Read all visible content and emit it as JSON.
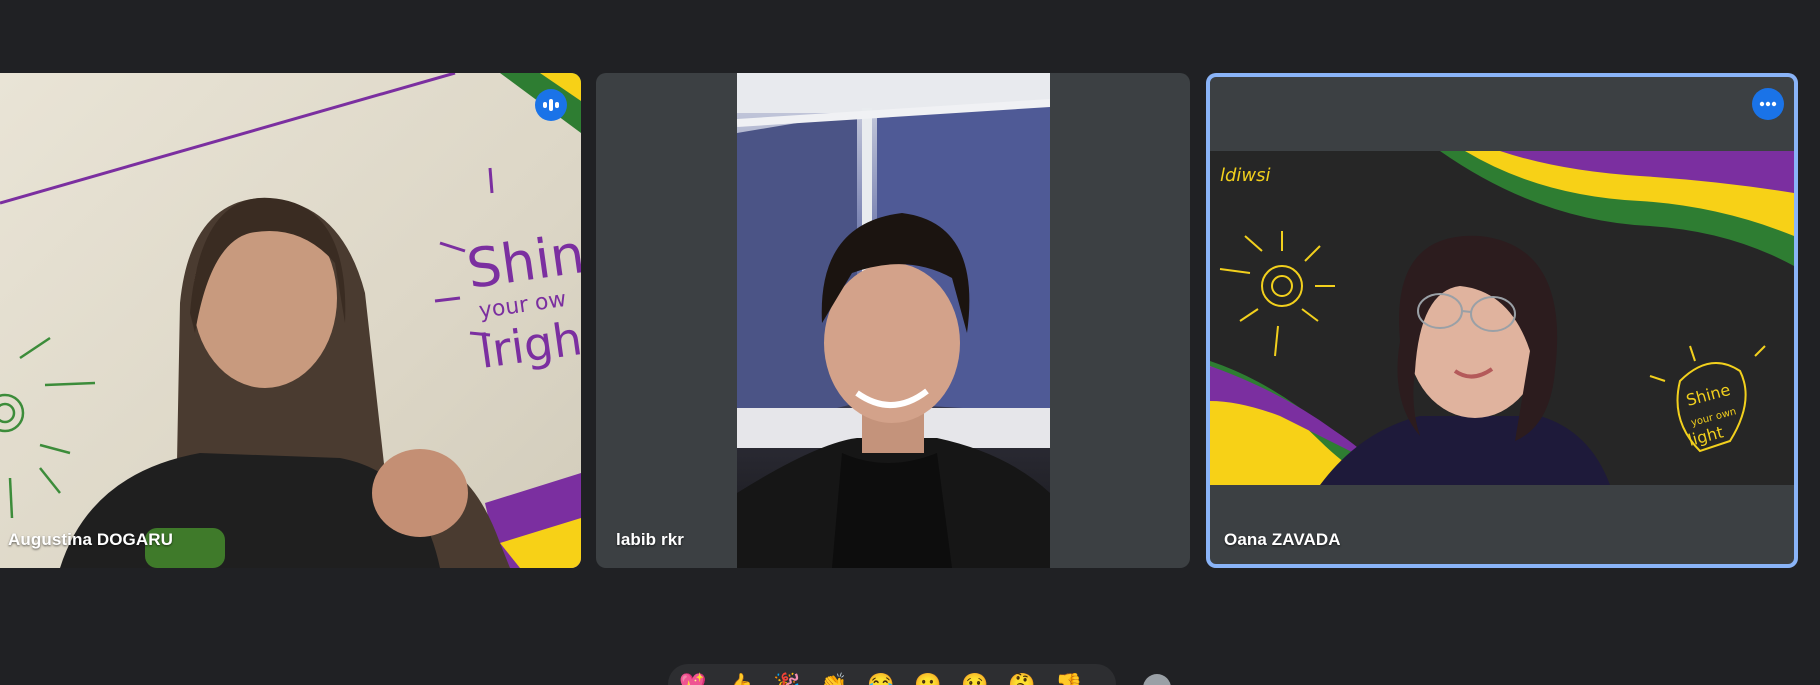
{
  "participants": [
    {
      "name": "Augustina DOGARU",
      "speaking_indicator": "audio-wave-icon"
    },
    {
      "name": "labib rkr"
    },
    {
      "name": "Oana ZAVADA",
      "menu_icon": "more-options-icon",
      "pinned_highlight": true
    }
  ],
  "doodles": {
    "shine_text": "Shine",
    "your_own_text": "your own",
    "light_text": "light"
  },
  "reactions": [
    "💖",
    "👍",
    "🎉",
    "👏",
    "😂",
    "😮",
    "😢",
    "🤔",
    "👎"
  ],
  "colors": {
    "background": "#202124",
    "tile": "#3c4043",
    "accent": "#1a73e8",
    "highlight": "#8ab4f8",
    "purple": "#7b2fa0",
    "yellow": "#f7d117",
    "green": "#2e7d32"
  }
}
